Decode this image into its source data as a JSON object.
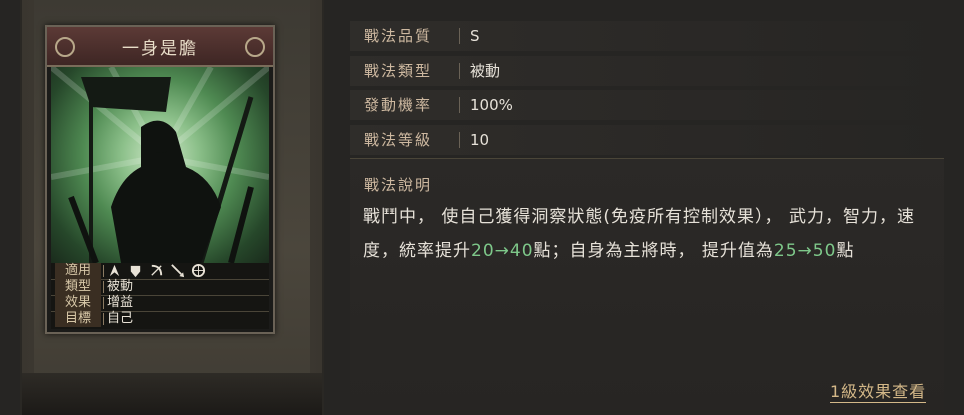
{
  "card": {
    "title": "一身是膽",
    "stats": [
      {
        "key": "適用",
        "value": ""
      },
      {
        "key": "類型",
        "value": "被動"
      },
      {
        "key": "效果",
        "value": "增益"
      },
      {
        "key": "目標",
        "value": "自己"
      }
    ],
    "troop_icons": [
      "cavalry-icon",
      "shield-icon",
      "bow-icon",
      "spear-icon",
      "wheel-icon"
    ]
  },
  "attributes": [
    {
      "key": "戰法品質",
      "value": "S"
    },
    {
      "key": "戰法類型",
      "value": "被動"
    },
    {
      "key": "發動機率",
      "value": "100%"
    },
    {
      "key": "戰法等級",
      "value": "10"
    }
  ],
  "description": {
    "title": "戰法說明",
    "text_1": "戰鬥中， 使自己獲得洞察狀態(免疫所有控制效果）， 武力，智力，速度，統率提升",
    "num_1": "20→40",
    "text_2": "點；自身為主將時， 提升值為",
    "num_2": "25→50",
    "text_3": "點"
  },
  "link_label": "1級效果查看",
  "colors": {
    "highlight_number": "#7ec88a",
    "accent_gold": "#d4b888"
  }
}
